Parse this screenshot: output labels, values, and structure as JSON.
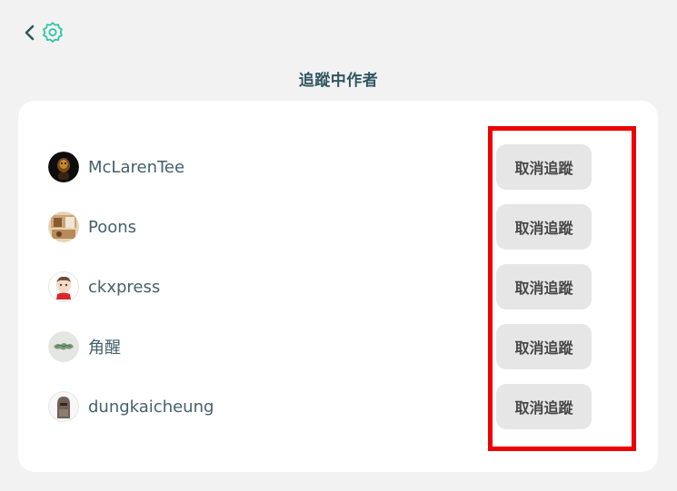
{
  "header": {
    "title": "追蹤中作者"
  },
  "following": [
    {
      "username": "McLarenTee",
      "unfollow_label": "取消追蹤"
    },
    {
      "username": "Poons",
      "unfollow_label": "取消追蹤"
    },
    {
      "username": "ckxpress",
      "unfollow_label": "取消追蹤"
    },
    {
      "username": "角醒",
      "unfollow_label": "取消追蹤"
    },
    {
      "username": "dungkaicheung",
      "unfollow_label": "取消追蹤"
    }
  ],
  "colors": {
    "accent": "#2ec4a5",
    "title_text": "#2f5660",
    "username_text": "#44616a",
    "button_bg": "#e6e6e6",
    "highlight": "#ee0000",
    "page_bg": "#f2f2f2"
  },
  "icons": [
    "chevron-left-icon",
    "gear-icon"
  ]
}
